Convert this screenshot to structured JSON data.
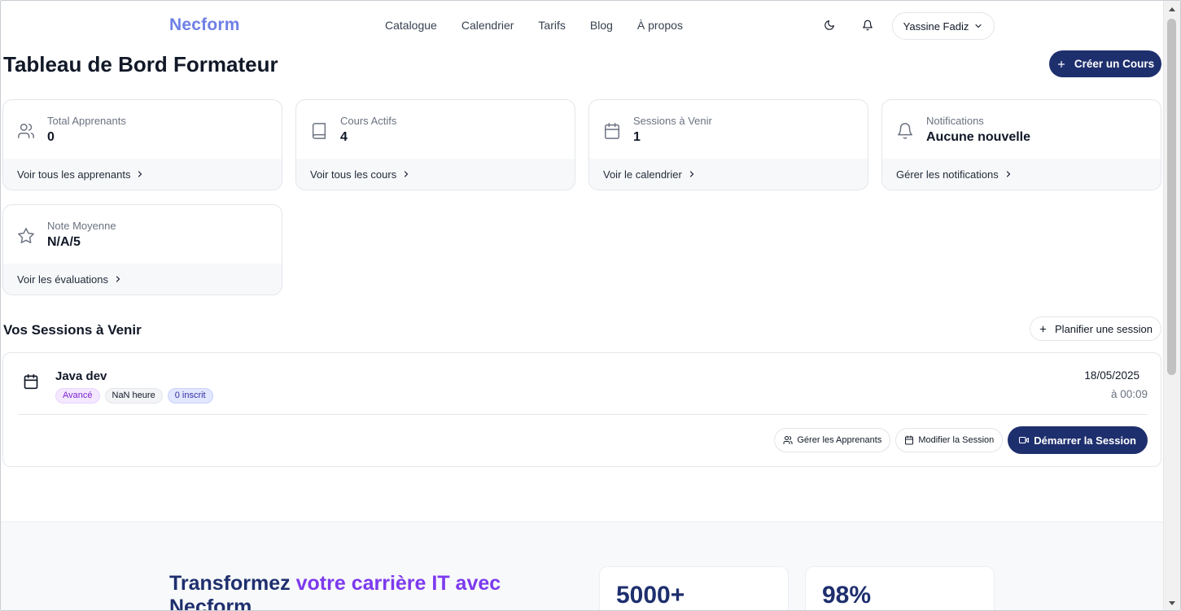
{
  "header": {
    "logo": "Necform",
    "nav": [
      "Catalogue",
      "Calendrier",
      "Tarifs",
      "Blog",
      "À propos"
    ],
    "user_name": "Yassine Fadiz"
  },
  "page": {
    "title": "Tableau de Bord Formateur",
    "create_button": "Créer un Cours"
  },
  "stats": [
    {
      "icon": "users-icon",
      "label": "Total Apprenants",
      "value": "0",
      "link": "Voir tous les apprenants"
    },
    {
      "icon": "book-icon",
      "label": "Cours Actifs",
      "value": "4",
      "link": "Voir tous les cours"
    },
    {
      "icon": "calendar-icon",
      "label": "Sessions à Venir",
      "value": "1",
      "link": "Voir le calendrier"
    },
    {
      "icon": "bell-icon",
      "label": "Notifications",
      "value": "Aucune nouvelle",
      "link": "Gérer les notifications"
    },
    {
      "icon": "star-icon",
      "label": "Note Moyenne",
      "value": "N/A/5",
      "link": "Voir les évaluations"
    }
  ],
  "sessions": {
    "title": "Vos Sessions à Venir",
    "plan_button": "Planifier une session",
    "items": [
      {
        "name": "Java dev",
        "level": "Avancé",
        "duration": "NaN heure",
        "enrolled": "0 inscrit",
        "date": "18/05/2025",
        "time": "à 00:09",
        "actions": {
          "manage": "Gérer les Apprenants",
          "edit": "Modifier la Session",
          "start": "Démarrer la Session"
        }
      }
    ]
  },
  "footer": {
    "hero_part1": "Transformez ",
    "hero_part2": "votre carrière IT avec",
    "hero_part3": "Necform",
    "stat1": "5000+",
    "stat2": "98%"
  },
  "colors": {
    "brand": "#6f7fe6",
    "primary": "#1e2f6e",
    "accent": "#7c3aed"
  }
}
